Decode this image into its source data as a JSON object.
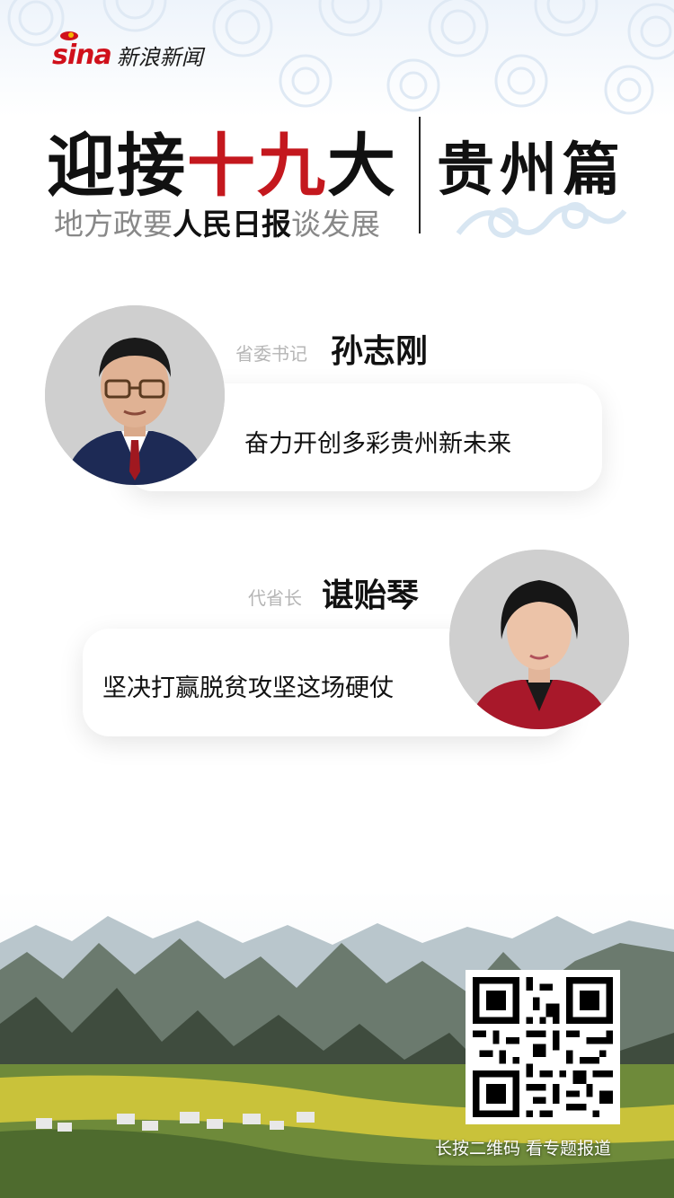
{
  "logo": {
    "brand": "sina",
    "name": "新浪新闻"
  },
  "title": {
    "prefix": "迎接",
    "highlight": "十九",
    "suffix": "大",
    "subtitle_pre": "地方政要",
    "subtitle_bold": "人民日报",
    "subtitle_post": "谈发展",
    "province": "贵州篇"
  },
  "officials": [
    {
      "role": "省委书记",
      "name": "孙志刚",
      "quote": "奋力开创多彩贵州新未来"
    },
    {
      "role": "代省长",
      "name": "谌贻琴",
      "quote": "坚决打赢脱贫攻坚这场硬仗"
    }
  ],
  "qr": {
    "caption": "长按二维码 看专题报道"
  },
  "colors": {
    "accent_red": "#c4181e",
    "brand_red": "#d0101b"
  }
}
